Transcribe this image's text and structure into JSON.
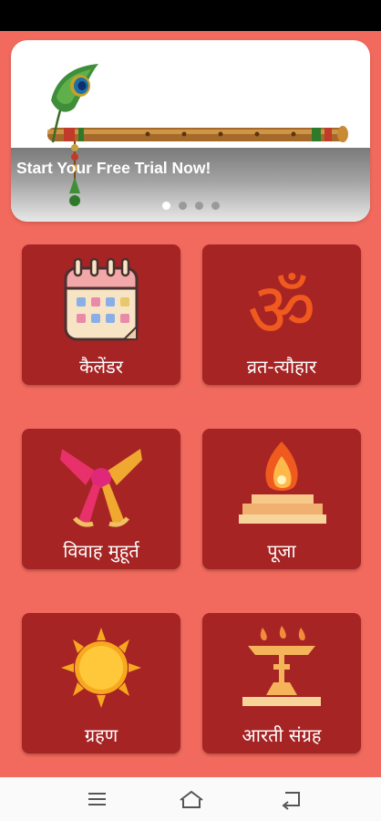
{
  "banner": {
    "caption": "Start Your Free Trial Now!",
    "slide_count": 4,
    "active_slide": 1
  },
  "tiles": [
    {
      "label": "कैलेंडर",
      "icon": "calendar-icon"
    },
    {
      "label": "व्रत-त्यौहार",
      "icon": "om-icon"
    },
    {
      "label": "विवाह मुहूर्त",
      "icon": "wedding-knot-icon"
    },
    {
      "label": "पूजा",
      "icon": "puja-fire-icon"
    },
    {
      "label": "ग्रहण",
      "icon": "sun-icon"
    },
    {
      "label": "आरती संग्रह",
      "icon": "diya-lamp-icon"
    }
  ],
  "nav": {
    "menu_icon": "menu-icon",
    "home_icon": "home-icon",
    "back_icon": "back-icon"
  },
  "colors": {
    "background": "#f26a5d",
    "tile": "#a62424",
    "om": "#f05a1e"
  }
}
